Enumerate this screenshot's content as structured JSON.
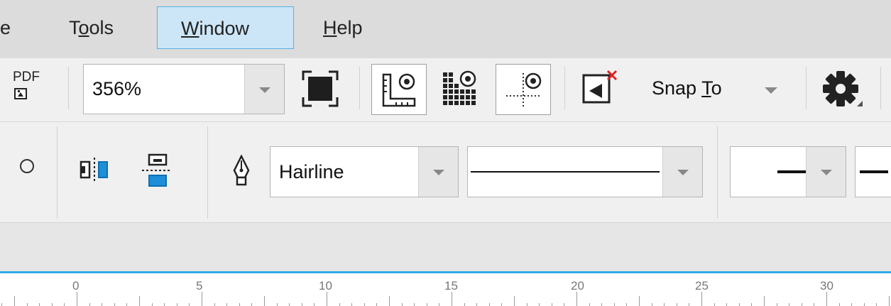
{
  "menu": {
    "cut_label": "e",
    "tools": {
      "before": "T",
      "mnemonic": "o",
      "after": "ols"
    },
    "window": {
      "before": "",
      "mnemonic": "W",
      "after": "indow"
    },
    "help": {
      "before": "",
      "mnemonic": "H",
      "after": "elp"
    }
  },
  "toolbar": {
    "pdf_label": "PDF",
    "zoom_value": "356%",
    "snap_label": {
      "before": "Snap ",
      "mnemonic": "T",
      "after": "o"
    },
    "icons": [
      "publish-pdf-icon",
      "full-screen-preview-icon",
      "show-rulers-icon",
      "show-grid-icon",
      "show-guidelines-icon",
      "alignment-guides-icon",
      "settings-gear-icon"
    ]
  },
  "propbar": {
    "outline_width": "Hairline",
    "icons": [
      "radio-circle-icon",
      "mirror-horizontal-icon",
      "mirror-vertical-icon",
      "outline-pen-icon"
    ]
  },
  "ruler": {
    "labels": [
      "0",
      "5",
      "10",
      "15",
      "20",
      "25",
      "30"
    ]
  },
  "colors": {
    "accent": "#31a8e8",
    "selection_blue": "#1e8ed8",
    "active_menu": "#cde6f7"
  }
}
